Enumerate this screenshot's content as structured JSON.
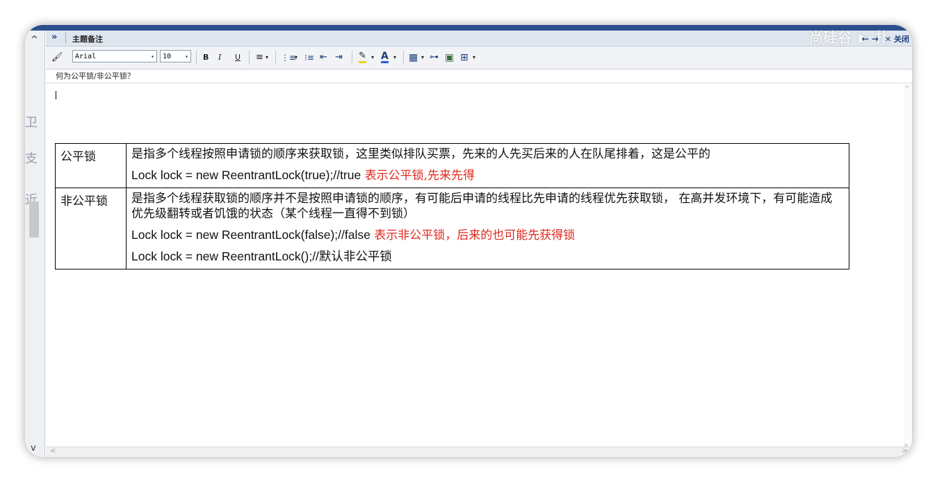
{
  "panel": {
    "title": "主题备注",
    "expand_glyph": "»",
    "watermark": "尚硅谷 ▶ 扑",
    "nav_glyph": "← →",
    "close_label": "✕ 关闭"
  },
  "toolbar": {
    "clear_format_icon": "brush-icon",
    "font_family": "Arial",
    "font_size": "10",
    "bold": "B",
    "italic": "I",
    "underline": "U",
    "align_glyph": "≡",
    "numbered_glyph": "⋮≡",
    "bullet_glyph": "⁝≡",
    "outdent_glyph": "⇤",
    "indent_glyph": "⇥",
    "highlight_glyph": "✎",
    "font_color_glyph": "A",
    "table_glyph": "▦",
    "link_glyph": "⊶",
    "image_glyph": "▣",
    "insert_glyph": "⊞",
    "dropdown_glyph": "▾",
    "accent_red": "#e0281f"
  },
  "subject": "何为公平锁/非公平锁？",
  "table": {
    "rows": [
      {
        "key": "公平锁",
        "desc": "是指多个线程按照申请锁的顺序来获取锁，这里类似排队买票，先来的人先买后来的人在队尾排着，这是公平的",
        "code": "Lock lock = new ReentrantLock(true);//true",
        "code_note": " 表示公平锁,先来先得"
      },
      {
        "key": "非公平锁",
        "desc": "是指多个线程获取锁的顺序并不是按照申请锁的顺序，有可能后申请的线程比先申请的线程优先获取锁， 在高并发环境下，有可能造成优先级翻转或者饥饿的状态（某个线程一直得不到锁）",
        "code": "Lock lock = new ReentrantLock(false);//false",
        "code_note": " 表示非公平锁，后来的也可能先获得锁",
        "code2": "Lock lock = new ReentrantLock();//默认非公平锁"
      }
    ]
  },
  "left_panel": {
    "up_arrow": "^",
    "down_arrow": "v"
  }
}
